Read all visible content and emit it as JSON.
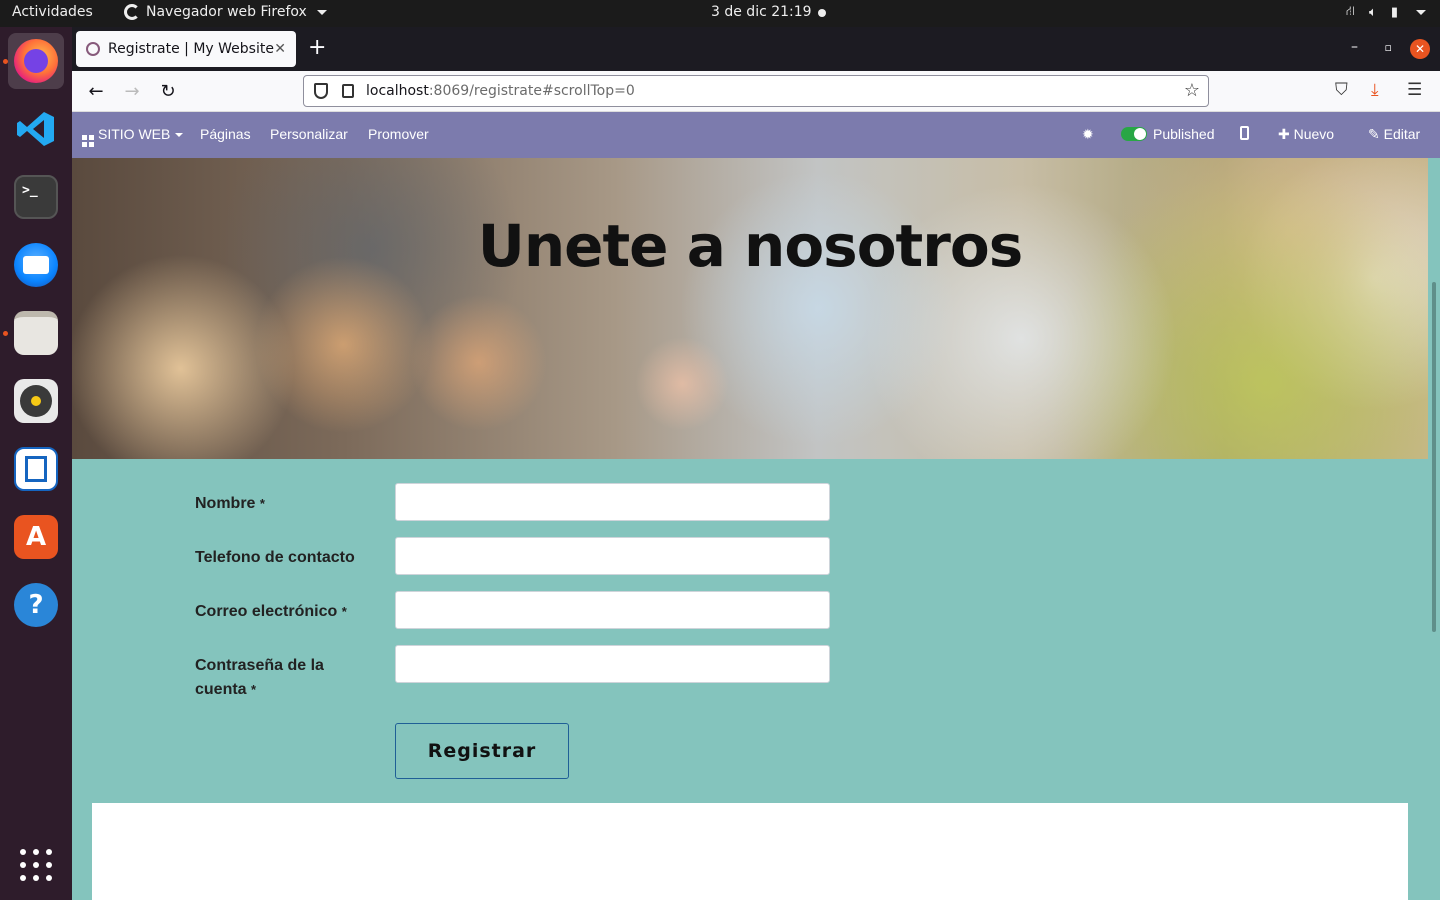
{
  "system": {
    "activities": "Actividades",
    "app_menu": "Navegador web Firefox",
    "clock": "3 de dic  21:19"
  },
  "dock": {
    "items": [
      "firefox-icon",
      "vscode-icon",
      "terminal-icon",
      "thunderbird-icon",
      "files-icon",
      "rhythmbox-icon",
      "libreoffice-writer-icon",
      "software-store-icon",
      "help-icon",
      "show-apps-icon"
    ],
    "terminal_glyph": ">_",
    "store_glyph": "A",
    "help_glyph": "?"
  },
  "browser": {
    "tab_title": "Registrate | My Website",
    "url_host": "localhost",
    "url_path": ":8069/registrate#scrollTop=0",
    "new_tab": "+",
    "close_tab": "✕"
  },
  "odoo_bar": {
    "site_menu": "SITIO WEB",
    "pages": "Páginas",
    "customize": "Personalizar",
    "promote": "Promover",
    "published": "Published",
    "new": "Nuevo",
    "edit": "Editar",
    "colors": {
      "bar": "#7c7bad",
      "toggle_on": "#28a745"
    }
  },
  "page": {
    "hero_title": "Unete a nosotros",
    "background": "#84c4bd",
    "form": {
      "fields": [
        {
          "label": "Nombre",
          "required": true,
          "value": ""
        },
        {
          "label": "Telefono de contacto",
          "required": false,
          "value": ""
        },
        {
          "label": "Correo electrónico",
          "required": true,
          "value": ""
        },
        {
          "label": "Contraseña de la cuenta",
          "required": true,
          "value": ""
        }
      ],
      "required_mark": "*",
      "submit_label": "Registrar"
    }
  }
}
